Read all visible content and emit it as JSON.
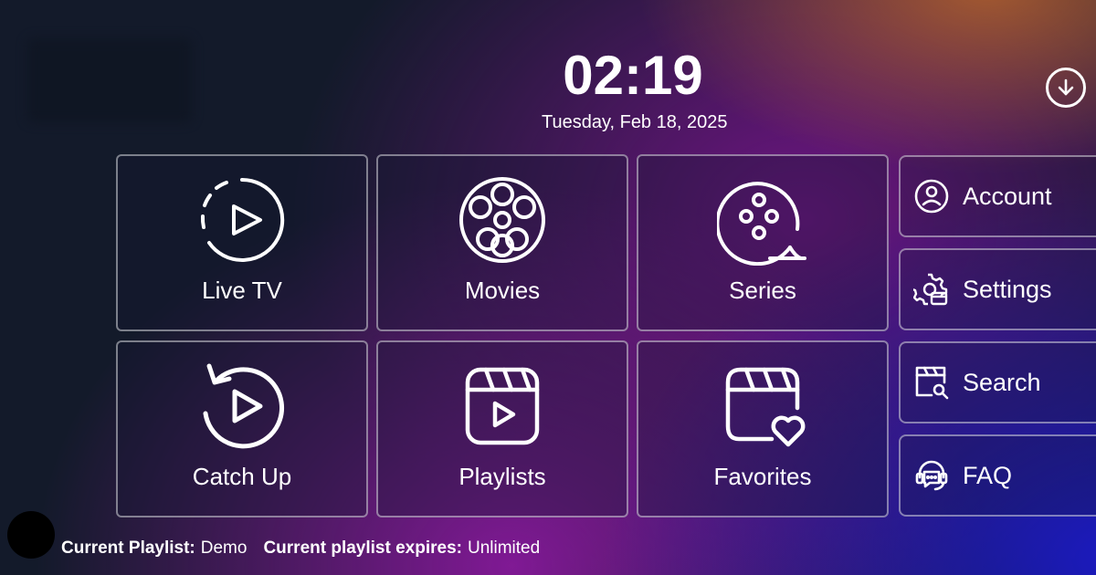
{
  "header": {
    "time": "02:19",
    "date": "Tuesday, Feb 18, 2025"
  },
  "download_icon": "download-circle-icon",
  "tiles": [
    {
      "label": "Live TV",
      "icon": "live-play-icon"
    },
    {
      "label": "Movies",
      "icon": "film-reel-icon"
    },
    {
      "label": "Series",
      "icon": "film-reel-tape-icon"
    },
    {
      "label": "Catch Up",
      "icon": "replay-icon"
    },
    {
      "label": "Playlists",
      "icon": "clapper-play-icon"
    },
    {
      "label": "Favorites",
      "icon": "clapper-heart-icon"
    }
  ],
  "side_menu": [
    {
      "label": "Account",
      "icon": "user-circle-icon"
    },
    {
      "label": "Settings",
      "icon": "gear-icon"
    },
    {
      "label": "Search",
      "icon": "clapper-search-icon"
    },
    {
      "label": "FAQ",
      "icon": "support-headset-icon"
    }
  ],
  "footer": {
    "playlist_key": "Current Playlist:",
    "playlist_value": "Demo",
    "expires_key": "Current playlist expires:",
    "expires_value": "Unlimited"
  },
  "colors": {
    "background": "#131a2a",
    "accent_purple": "#8c19a0",
    "accent_blue": "#1c1ac8",
    "accent_orange": "#c86e28"
  }
}
